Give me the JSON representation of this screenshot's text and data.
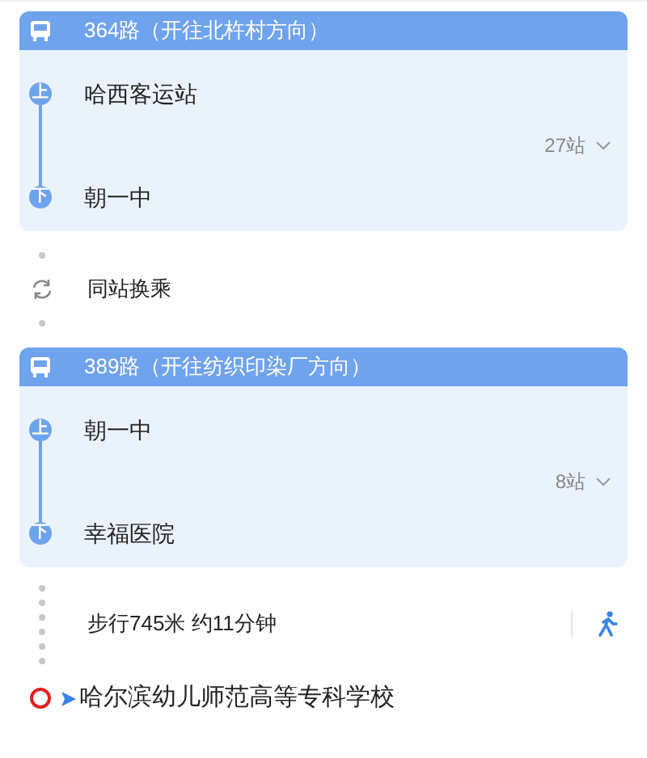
{
  "segments": [
    {
      "kind": "bus",
      "title": "364路（开往北杵村方向）",
      "board": {
        "marker": "上",
        "name": "哈西客运站"
      },
      "stops": "27站",
      "alight": {
        "marker": "下",
        "name": "朝一中"
      }
    },
    {
      "kind": "transfer",
      "text": "同站换乘"
    },
    {
      "kind": "bus",
      "title": "389路（开往纺织印染厂方向）",
      "board": {
        "marker": "上",
        "name": "朝一中"
      },
      "stops": "8站",
      "alight": {
        "marker": "下",
        "name": "幸福医院"
      }
    },
    {
      "kind": "walk",
      "text": "步行745米 约11分钟"
    }
  ],
  "destination": {
    "name": "哈尔滨幼儿师范高等专科学校"
  }
}
